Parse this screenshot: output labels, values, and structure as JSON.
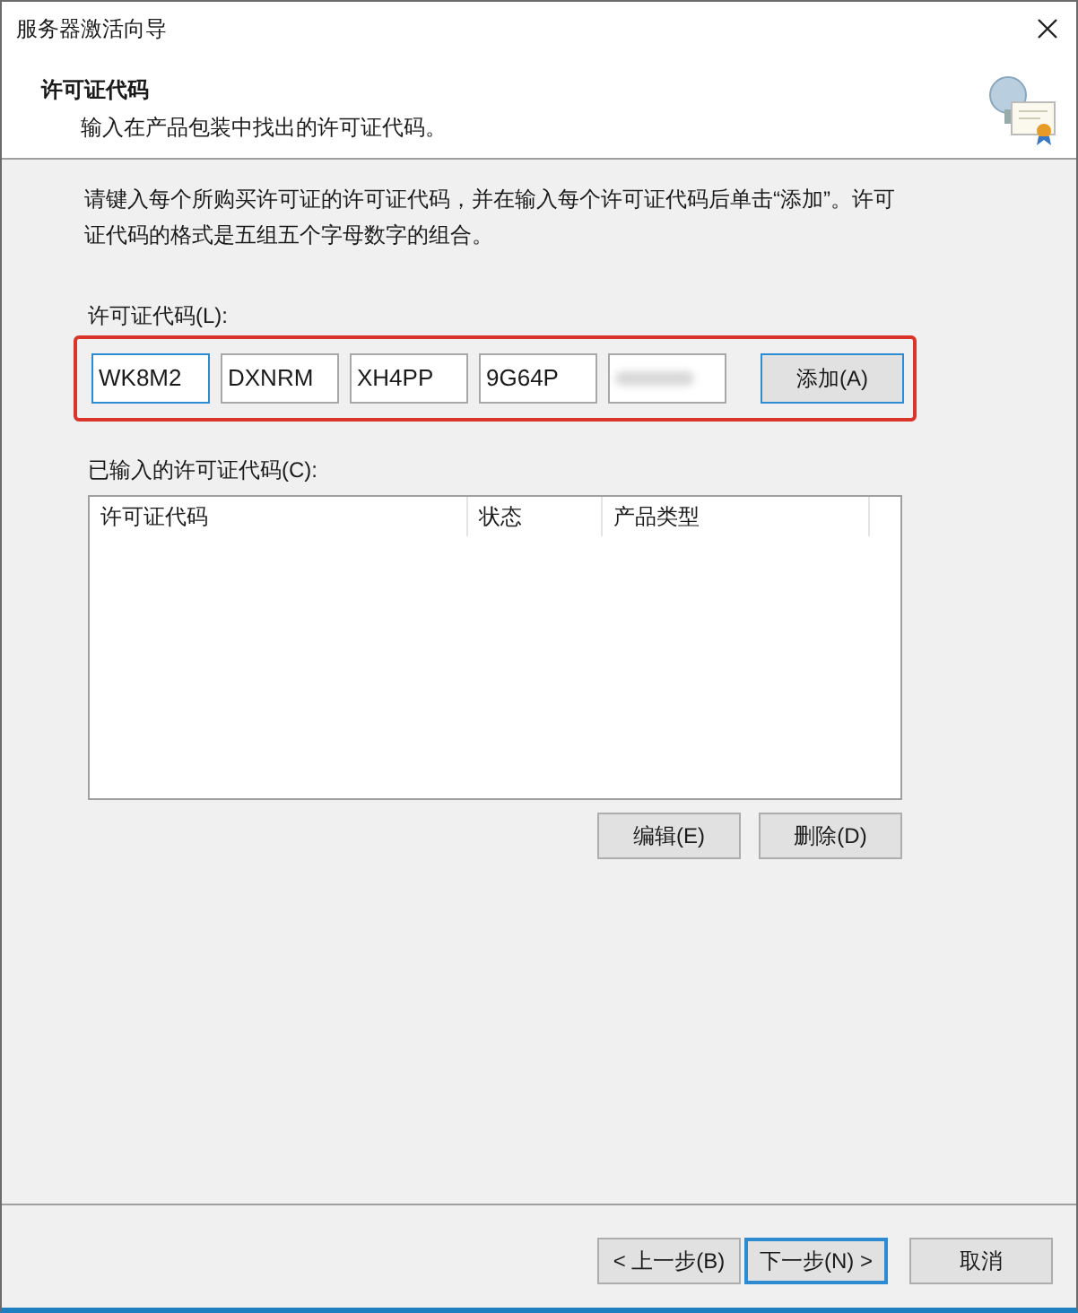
{
  "window": {
    "title": "服务器激活向导"
  },
  "header": {
    "title": "许可证代码",
    "subtitle": "输入在产品包装中找出的许可证代码。"
  },
  "instructions": "请键入每个所购买许可证的许可证代码，并在输入每个许可证代码后单击“添加”。许可证代码的格式是五组五个字母数字的组合。",
  "key_entry": {
    "label": "许可证代码(L):",
    "highlighted": true,
    "fields": [
      {
        "value": "WK8M2",
        "focused": true,
        "blurred": false
      },
      {
        "value": "DXNRM",
        "focused": false,
        "blurred": false
      },
      {
        "value": "XH4PP",
        "focused": false,
        "blurred": false
      },
      {
        "value": "9G64P",
        "focused": false,
        "blurred": false
      },
      {
        "focused": false,
        "blurred": true
      }
    ],
    "add_button": "添加(A)"
  },
  "entered": {
    "label": "已输入的许可证代码(C):",
    "columns": [
      "许可证代码",
      "状态",
      "产品类型"
    ],
    "buttons": [
      "编辑(E)",
      "删除(D)"
    ]
  },
  "footer": {
    "buttons": [
      {
        "label": "< 上一步(B)",
        "default": false
      },
      {
        "label": "下一步(N) >",
        "default": true
      },
      {
        "label": "取消",
        "default": false
      }
    ]
  }
}
